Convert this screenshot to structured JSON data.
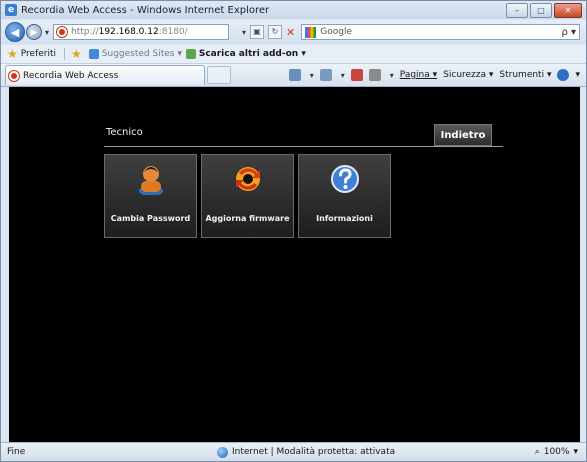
{
  "window": {
    "title": "Recordia Web Access - Windows Internet Explorer",
    "controls": [
      "–",
      "□",
      "✕"
    ]
  },
  "addressbar": {
    "url_scheme": "http://",
    "url_host": "192.168.0.12",
    "url_port": ":8180/",
    "refresh_label": "↻",
    "stop_label": "✕",
    "search_placeholder": "Google",
    "search_button": "ρ ▾"
  },
  "favorites": {
    "favorites_label": "Preferiti",
    "suggested_sites": "Suggested Sites ▾",
    "more_addons": "Scarica altri add-on ▾"
  },
  "tab": {
    "title": "Recordia Web Access"
  },
  "commandbar": {
    "page": "Pagina ▾",
    "security": "Sicurezza ▾",
    "tools": "Strumenti ▾",
    "help": "▾"
  },
  "app": {
    "section_title": "Tecnico",
    "back_label": "Indietro",
    "tiles": [
      {
        "label": "Cambia Password",
        "icon": "user-icon"
      },
      {
        "label": "Aggiorna firmware",
        "icon": "update-arrows-icon"
      },
      {
        "label": "Informazioni",
        "icon": "question-icon"
      }
    ]
  },
  "statusbar": {
    "left": "Fine",
    "zone": "Internet | Modalità protetta: attivata",
    "zoom": "100%"
  }
}
